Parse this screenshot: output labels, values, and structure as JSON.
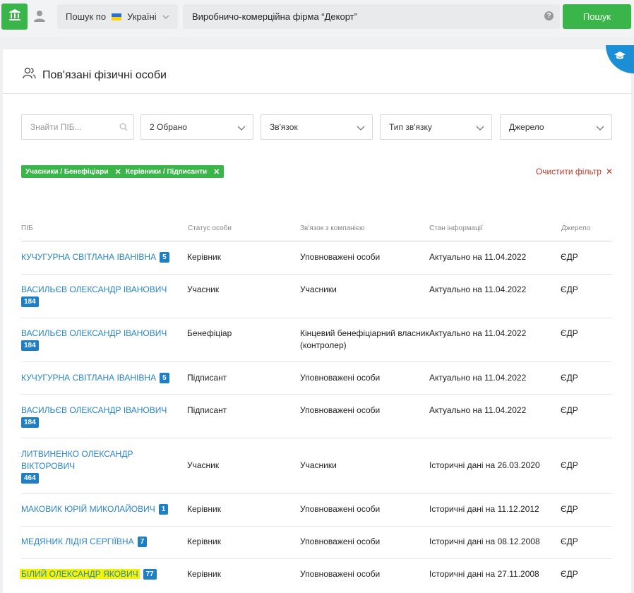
{
  "topbar": {
    "home_icon": "bank-icon",
    "user_icon": "user-icon",
    "scope_label": "Пошук по",
    "scope_value": "Україні",
    "search_value": "Виробничо-комерційна фірма “Декорт”",
    "help_icon": "question-icon",
    "search_button": "Пошук"
  },
  "panel": {
    "title": "Пов'язані фізичні особи",
    "title_icon": "people-icon",
    "corner_icon": "graduation-cap-icon"
  },
  "filters": {
    "name_placeholder": "Знайти ПІБ...",
    "status": "2 Обрано",
    "relation": "Зв'язок",
    "relation_type": "Тип зв'язку",
    "source": "Джерело"
  },
  "active_tags": [
    "Учасники / Бенефіціари",
    "Керівники / Підписанти"
  ],
  "clear_filter": "Очистити фільтр",
  "table": {
    "headers": [
      "ПІБ",
      "Статус особи",
      "Зв'язок з компанією",
      "Стан інформації",
      "Джерело"
    ],
    "rows": [
      {
        "name": "КУЧУГУРНА СВІТЛАНА ІВАНІВНА",
        "count": "5",
        "status": "Керівник",
        "relation": "Уповноважені особи",
        "state": "Актуально на 11.04.2022",
        "source": "ЄДР"
      },
      {
        "name": "ВАСИЛЬЄВ ОЛЕКСАНДР ІВАНОВИЧ",
        "count": "184",
        "status": "Учасник",
        "relation": "Учасники",
        "state": "Актуально на 11.04.2022",
        "source": "ЄДР"
      },
      {
        "name": "ВАСИЛЬЄВ ОЛЕКСАНДР ІВАНОВИЧ",
        "count": "184",
        "status": "Бенефіціар",
        "relation": "Кінцевий бенефіціарний власник (контролер)",
        "state": "Актуально на 11.04.2022",
        "source": "ЄДР"
      },
      {
        "name": "КУЧУГУРНА СВІТЛАНА ІВАНІВНА",
        "count": "5",
        "status": "Підписант",
        "relation": "Уповноважені особи",
        "state": "Актуально на 11.04.2022",
        "source": "ЄДР"
      },
      {
        "name": "ВАСИЛЬЄВ ОЛЕКСАНДР ІВАНОВИЧ",
        "count": "184",
        "status": "Підписант",
        "relation": "Уповноважені особи",
        "state": "Актуально на 11.04.2022",
        "source": "ЄДР"
      },
      {
        "name": "ЛИТВИНЕНКО ОЛЕКСАНДР ВІКТОРОВИЧ",
        "count": "464",
        "status": "Учасник",
        "relation": "Учасники",
        "state": "Історичні дані на 26.03.2020",
        "source": "ЄДР"
      },
      {
        "name": "МАКОВИК ЮРІЙ МИКОЛАЙОВИЧ",
        "count": "1",
        "status": "Керівник",
        "relation": "Уповноважені особи",
        "state": "Історичні дані на 11.12.2012",
        "source": "ЄДР"
      },
      {
        "name": "МЕДЯНИК ЛІДІЯ СЕРГІЇВНА",
        "count": "7",
        "status": "Керівник",
        "relation": "Уповноважені особи",
        "state": "Історичні дані на 08.12.2008",
        "source": "ЄДР"
      },
      {
        "name": "БІЛИЙ ОЛЕКСАНДР ЯКОВИЧ",
        "count": "77",
        "status": "Керівник",
        "relation": "Уповноважені особи",
        "state": "Історичні дані на 27.11.2008",
        "source": "ЄДР"
      }
    ]
  }
}
